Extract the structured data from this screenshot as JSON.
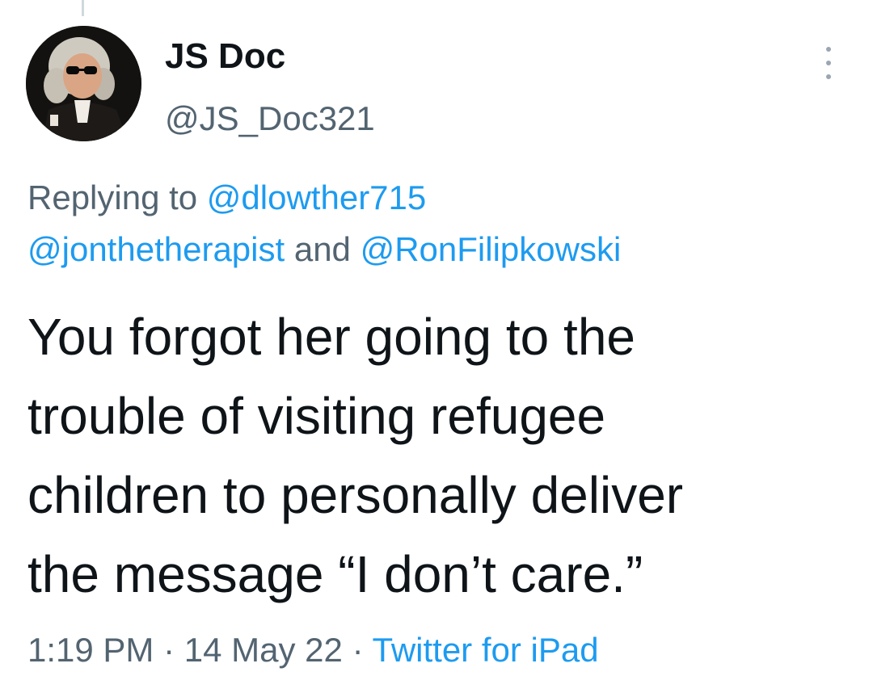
{
  "author": {
    "display_name": "JS Doc",
    "handle": "@JS_Doc321"
  },
  "reply_context": {
    "prefix": "Replying to",
    "mentions": [
      "@dlowther715",
      "@jonthetherapist",
      "@RonFilipkowski"
    ],
    "conjunction": "and"
  },
  "tweet": {
    "line1": "You forgot her going to the",
    "line2": "trouble of visiting refugee",
    "line3": "children to personally deliver",
    "line4": "the message “I don’t care.”"
  },
  "meta": {
    "time": "1:19 PM",
    "separator": "·",
    "date": "14 May 22",
    "source": "Twitter for iPad"
  },
  "icons": {
    "more": "more-vertical-icon",
    "avatar": "avatar-portrait"
  },
  "colors": {
    "text": "#0f1419",
    "secondary": "#536471",
    "link": "#1d9bf0"
  }
}
